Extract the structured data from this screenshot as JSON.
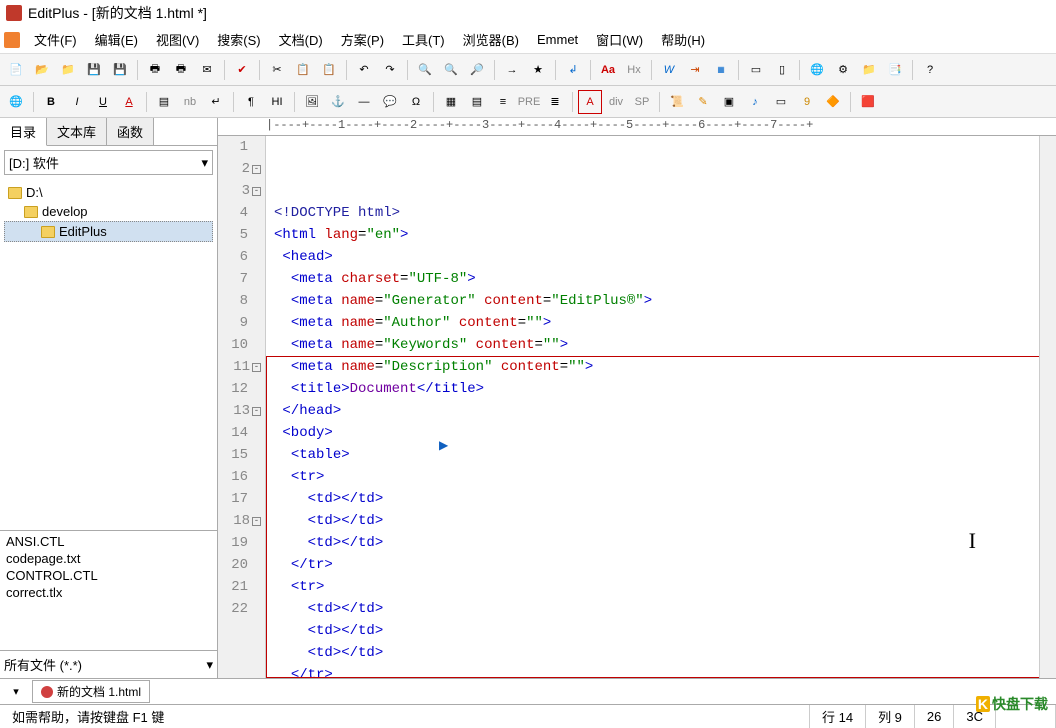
{
  "title": "EditPlus - [新的文档 1.html *]",
  "menu": [
    "文件(F)",
    "编辑(E)",
    "视图(V)",
    "搜索(S)",
    "文档(D)",
    "方案(P)",
    "工具(T)",
    "浏览器(B)",
    "Emmet",
    "窗口(W)",
    "帮助(H)"
  ],
  "side_tabs": {
    "dir": "目录",
    "lib": "文本库",
    "func": "函数"
  },
  "drive": "[D:] 软件",
  "tree": [
    {
      "label": "D:\\",
      "indent": 0
    },
    {
      "label": "develop",
      "indent": 1
    },
    {
      "label": "EditPlus",
      "indent": 2,
      "selected": true
    }
  ],
  "files": [
    "ANSI.CTL",
    "codepage.txt",
    "CONTROL.CTL",
    "correct.tlx"
  ],
  "filter": "所有文件 (*.*)",
  "ruler": "|----+----1----+----2----+----3----+----4----+----5----+----6----+----7----+",
  "code": [
    {
      "n": 1,
      "html": "<span class='doctype'>&lt;!DOCTYPE html&gt;</span>"
    },
    {
      "n": 2,
      "fold": true,
      "html": "<span class='tag'>&lt;html</span> <span class='attr'>lang</span>=<span class='val'>\"en\"</span><span class='tag'>&gt;</span>"
    },
    {
      "n": 3,
      "fold": true,
      "html": " <span class='tag'>&lt;head&gt;</span>"
    },
    {
      "n": 4,
      "html": "  <span class='tag'>&lt;meta</span> <span class='attr'>charset</span>=<span class='val'>\"UTF-8\"</span><span class='tag'>&gt;</span>"
    },
    {
      "n": 5,
      "html": "  <span class='tag'>&lt;meta</span> <span class='attr'>name</span>=<span class='val'>\"Generator\"</span> <span class='attr'>content</span>=<span class='val'>\"EditPlus®\"</span><span class='tag'>&gt;</span>"
    },
    {
      "n": 6,
      "html": "  <span class='tag'>&lt;meta</span> <span class='attr'>name</span>=<span class='val'>\"Author\"</span> <span class='attr'>content</span>=<span class='val'>\"\"</span><span class='tag'>&gt;</span>"
    },
    {
      "n": 7,
      "html": "  <span class='tag'>&lt;meta</span> <span class='attr'>name</span>=<span class='val'>\"Keywords\"</span> <span class='attr'>content</span>=<span class='val'>\"\"</span><span class='tag'>&gt;</span>"
    },
    {
      "n": 8,
      "html": "  <span class='tag'>&lt;meta</span> <span class='attr'>name</span>=<span class='val'>\"Description\"</span> <span class='attr'>content</span>=<span class='val'>\"\"</span><span class='tag'>&gt;</span>"
    },
    {
      "n": 9,
      "html": "  <span class='tag'>&lt;title&gt;</span><span class='txt'>Document</span><span class='tag'>&lt;/title&gt;</span>"
    },
    {
      "n": 10,
      "html": " <span class='tag'>&lt;/head&gt;</span>"
    },
    {
      "n": 11,
      "fold": true,
      "html": " <span class='tag'>&lt;body&gt;</span>"
    },
    {
      "n": 12,
      "html": "  <span class='tag'>&lt;table&gt;</span>"
    },
    {
      "n": 13,
      "fold": true,
      "html": "  <span class='tag'>&lt;tr&gt;</span>"
    },
    {
      "n": 14,
      "current": true,
      "html": "    <span class='tag'>&lt;td&gt;&lt;/td&gt;</span>"
    },
    {
      "n": 15,
      "html": "    <span class='tag'>&lt;td&gt;&lt;/td&gt;</span>"
    },
    {
      "n": 16,
      "html": "    <span class='tag'>&lt;td&gt;&lt;/td&gt;</span>"
    },
    {
      "n": 17,
      "html": "  <span class='tag'>&lt;/tr&gt;</span>"
    },
    {
      "n": 18,
      "fold": true,
      "html": "  <span class='tag'>&lt;tr&gt;</span>"
    },
    {
      "n": 19,
      "html": "    <span class='tag'>&lt;td&gt;&lt;/td&gt;</span>"
    },
    {
      "n": 20,
      "html": "    <span class='tag'>&lt;td&gt;&lt;/td&gt;</span>"
    },
    {
      "n": 21,
      "html": "    <span class='tag'>&lt;td&gt;&lt;/td&gt;</span>"
    },
    {
      "n": 22,
      "html": "  <span class='tag'>&lt;/tr&gt;</span>"
    }
  ],
  "doc_tab": "新的文档 1.html",
  "status": {
    "help": "如需帮助，请按键盘 F1 键",
    "line": "行 14",
    "col": "列 9",
    "len": "26",
    "sel": "3C"
  },
  "watermark": "快盘下载"
}
